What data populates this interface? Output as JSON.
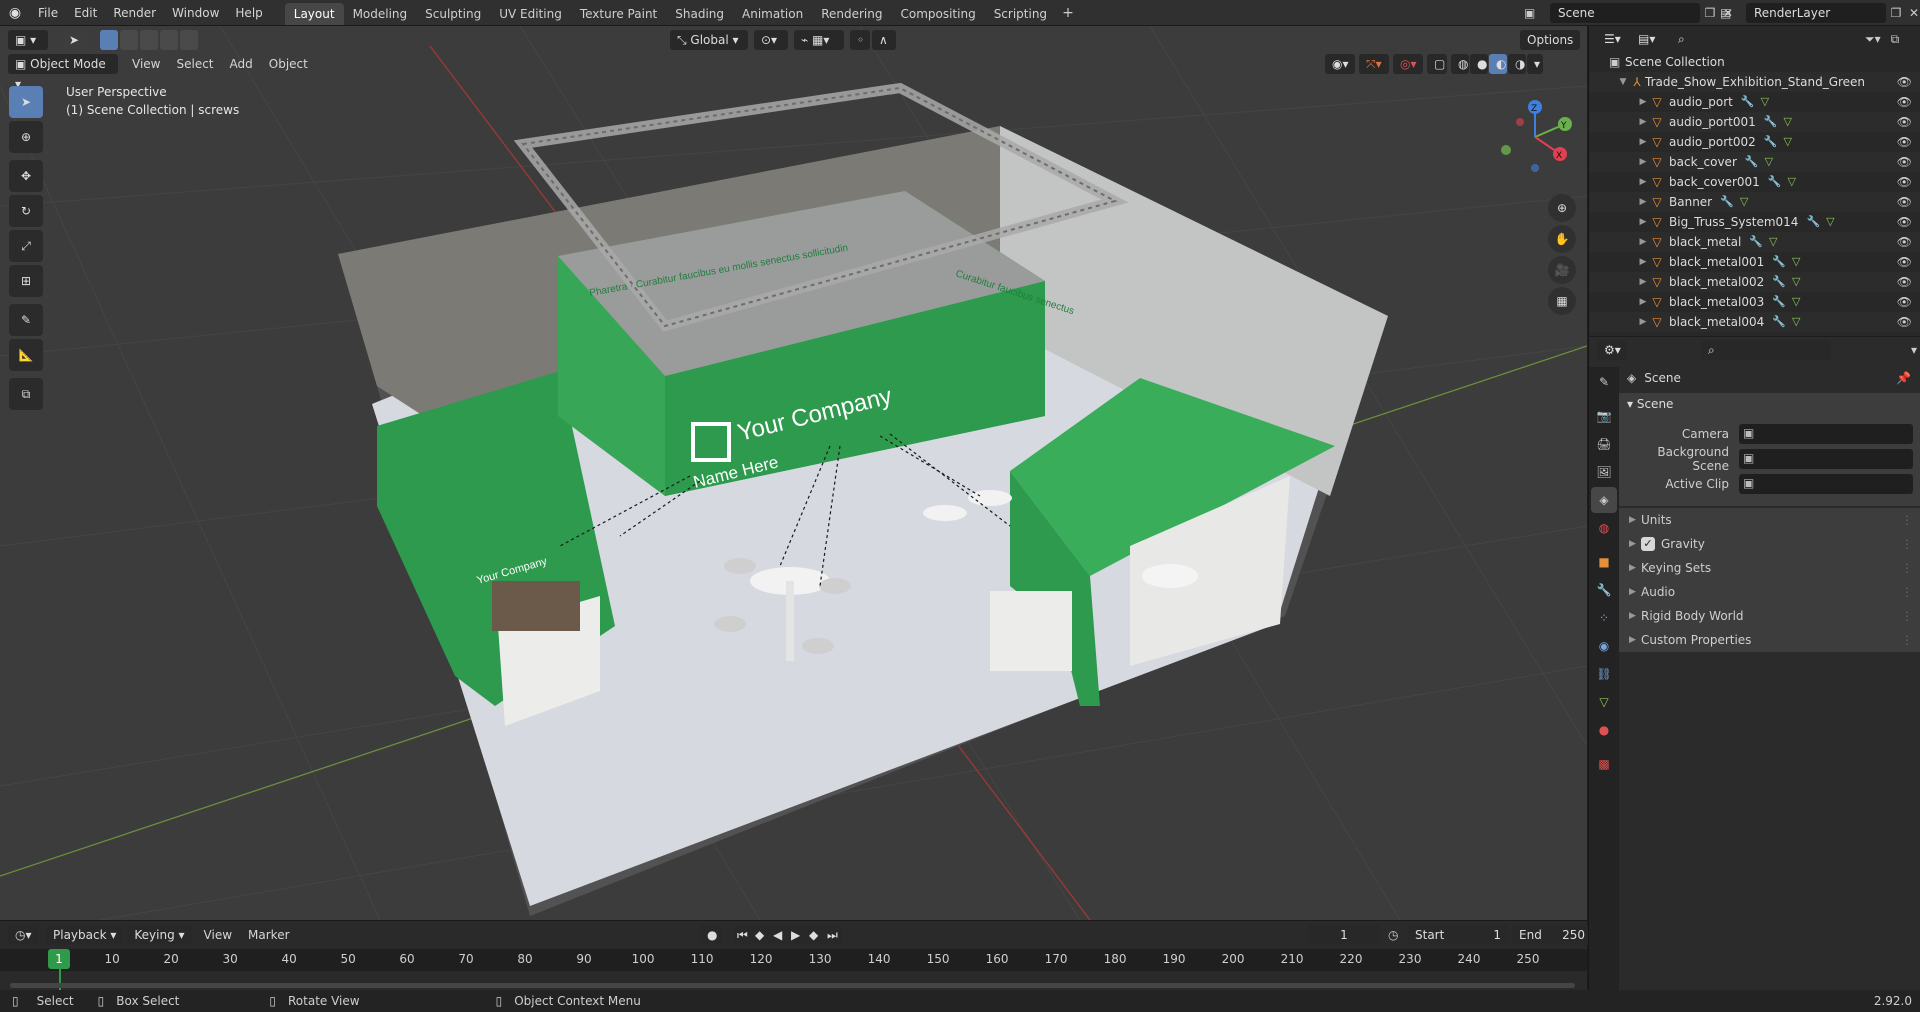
{
  "app": {
    "menus": [
      "File",
      "Edit",
      "Render",
      "Window",
      "Help"
    ],
    "workspaces": [
      "Layout",
      "Modeling",
      "Sculpting",
      "UV Editing",
      "Texture Paint",
      "Shading",
      "Animation",
      "Rendering",
      "Compositing",
      "Scripting"
    ],
    "active_workspace": "Layout",
    "scene_name": "Scene",
    "view_layer": "RenderLayer"
  },
  "viewport": {
    "mode": "Object Mode",
    "menus": [
      "View",
      "Select",
      "Add",
      "Object"
    ],
    "transform": "Global",
    "options_label": "Options",
    "overlay_title": "User Perspective",
    "overlay_subtitle": "(1) Scene Collection | screws",
    "booth": {
      "header_company": "Your Company",
      "header_tagline": "Name Here",
      "small_company": "Your Company",
      "wall_text_left": "Pharetra · Curabitur faucibus eu mollis senectus sollicitudin",
      "wall_text_right": "Curabitur faucibus senectus"
    },
    "axes": {
      "x": "X",
      "y": "Y",
      "z": "Z"
    }
  },
  "timeline": {
    "menus": [
      "Playback",
      "Keying",
      "View",
      "Marker"
    ],
    "current_frame": "1",
    "start_label": "Start",
    "start_value": "1",
    "end_label": "End",
    "end_value": "250",
    "ticks": [
      "1",
      "10",
      "20",
      "30",
      "40",
      "50",
      "60",
      "70",
      "80",
      "90",
      "100",
      "110",
      "120",
      "130",
      "140",
      "150",
      "160",
      "170",
      "180",
      "190",
      "200",
      "210",
      "220",
      "230",
      "240",
      "250"
    ]
  },
  "outliner": {
    "root": "Scene Collection",
    "collection": "Trade_Show_Exhibition_Stand_Green",
    "items": [
      "audio_port",
      "audio_port001",
      "audio_port002",
      "back_cover",
      "back_cover001",
      "Banner",
      "Big_Truss_System014",
      "black_metal",
      "black_metal001",
      "black_metal002",
      "black_metal003",
      "black_metal004"
    ]
  },
  "properties": {
    "breadcrumb": "Scene",
    "panel_title": "Scene",
    "fields": [
      {
        "label": "Camera",
        "value": ""
      },
      {
        "label": "Background Scene",
        "value": ""
      },
      {
        "label": "Active Clip",
        "value": ""
      }
    ],
    "subpanels": [
      "Units",
      "Gravity",
      "Keying Sets",
      "Audio",
      "Rigid Body World",
      "Custom Properties"
    ],
    "gravity_checked": true
  },
  "status": {
    "select": "Select",
    "box_select": "Box Select",
    "rotate": "Rotate View",
    "context_menu": "Object Context Menu",
    "version": "2.92.0"
  },
  "colors": {
    "accent": "#5a7fb4",
    "booth_green": "#2e9a4e",
    "mesh_orange": "#e58f3a",
    "viewport_bg": "#3c3c3c"
  }
}
